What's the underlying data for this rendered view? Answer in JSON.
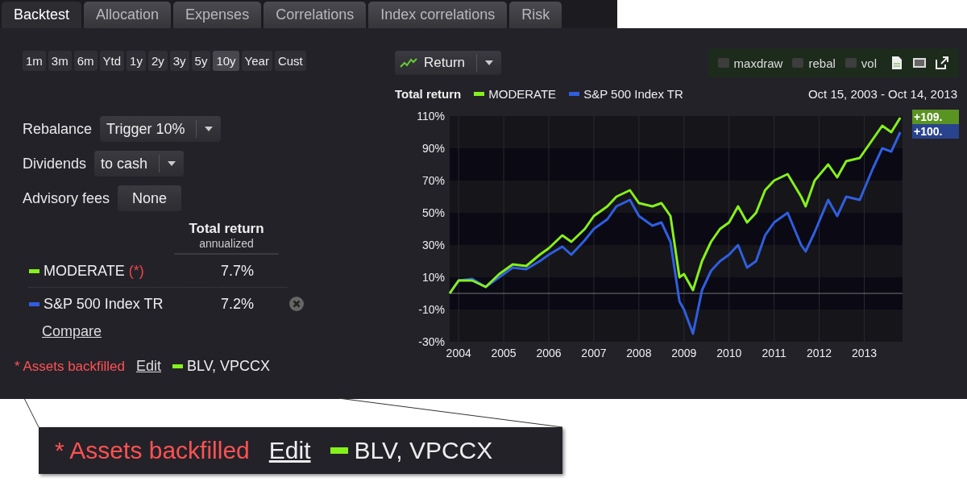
{
  "tabs": [
    {
      "label": "Backtest",
      "selected": true
    },
    {
      "label": "Allocation",
      "selected": false
    },
    {
      "label": "Expenses",
      "selected": false
    },
    {
      "label": "Correlations",
      "selected": false
    },
    {
      "label": "Index correlations",
      "selected": false
    },
    {
      "label": "Risk",
      "selected": false
    }
  ],
  "ranges": [
    {
      "label": "1m",
      "selected": false
    },
    {
      "label": "3m",
      "selected": false
    },
    {
      "label": "6m",
      "selected": false
    },
    {
      "label": "Ytd",
      "selected": false
    },
    {
      "label": "1y",
      "selected": false
    },
    {
      "label": "2y",
      "selected": false
    },
    {
      "label": "3y",
      "selected": false
    },
    {
      "label": "5y",
      "selected": false
    },
    {
      "label": "10y",
      "selected": true
    },
    {
      "label": "Year",
      "selected": false
    },
    {
      "label": "Cust",
      "selected": false
    }
  ],
  "settings": [
    {
      "label": "Rebalance",
      "kind": "dropdown",
      "value": "Trigger 10%"
    },
    {
      "label": "Dividends",
      "kind": "dropdown",
      "value": "to cash"
    },
    {
      "label": "Advisory fees",
      "kind": "button",
      "value": "None"
    }
  ],
  "results": {
    "header": "Total return",
    "subheader": "annualized",
    "rows": [
      {
        "name": "MODERATE",
        "note": "(*)",
        "value": "7.7%",
        "color": "#86f01c",
        "removable": false
      },
      {
        "name": "S&P 500 Index TR",
        "value": "7.2%",
        "color": "#2f5fe0",
        "removable": true
      }
    ],
    "compare": "Compare"
  },
  "footer": {
    "note": "* Assets backfilled",
    "edit": "Edit",
    "color": "#86f01c",
    "assets": "BLV, VPCCX"
  },
  "chart_toolbar": {
    "mode": "Return",
    "options": [
      {
        "label": "maxdraw",
        "checked": false
      },
      {
        "label": "rebal",
        "checked": false
      },
      {
        "label": "vol",
        "checked": false
      }
    ]
  },
  "chart_header": {
    "title": "Total return",
    "date_range": "Oct 15, 2003 - Oct 14, 2013"
  },
  "chart_data": {
    "type": "line",
    "x": [
      2003.8,
      2004.0,
      2004.3,
      2004.6,
      2004.9,
      2005.2,
      2005.5,
      2005.8,
      2006.0,
      2006.3,
      2006.5,
      2006.8,
      2007.0,
      2007.3,
      2007.5,
      2007.8,
      2008.0,
      2008.3,
      2008.5,
      2008.7,
      2008.9,
      2009.0,
      2009.2,
      2009.4,
      2009.6,
      2009.8,
      2010.0,
      2010.2,
      2010.4,
      2010.6,
      2010.8,
      2011.0,
      2011.3,
      2011.6,
      2011.7,
      2011.9,
      2012.2,
      2012.4,
      2012.6,
      2012.9,
      2013.2,
      2013.4,
      2013.6,
      2013.8
    ],
    "series": [
      {
        "name": "MODERATE",
        "color": "#86f01c",
        "values": [
          0,
          8,
          8,
          4,
          12,
          18,
          17,
          24,
          28,
          36,
          32,
          40,
          48,
          54,
          60,
          64,
          56,
          54,
          56,
          48,
          10,
          12,
          2,
          20,
          32,
          40,
          44,
          54,
          44,
          50,
          64,
          70,
          74,
          60,
          54,
          70,
          80,
          72,
          82,
          84,
          96,
          104,
          100,
          109
        ]
      },
      {
        "name": "S&P 500 Index TR",
        "color": "#2f5fe0",
        "values": [
          0,
          8,
          9,
          4,
          10,
          16,
          15,
          20,
          24,
          29,
          24,
          33,
          40,
          46,
          54,
          58,
          48,
          42,
          44,
          32,
          -5,
          -10,
          -25,
          2,
          14,
          20,
          24,
          30,
          16,
          20,
          36,
          44,
          50,
          30,
          26,
          38,
          58,
          48,
          60,
          58,
          78,
          90,
          88,
          100
        ]
      }
    ],
    "xlim": [
      2003.8,
      2013.85
    ],
    "ylim": [
      -30,
      110
    ],
    "grid": true,
    "annotations": [
      {
        "text": "+109."
      },
      {
        "text": "+100."
      }
    ],
    "xticks": [
      {
        "value": 2004,
        "label": "2004"
      },
      {
        "value": 2005,
        "label": "2005"
      },
      {
        "value": 2006,
        "label": "2006"
      },
      {
        "value": 2007,
        "label": "2007"
      },
      {
        "value": 2008,
        "label": "2008"
      },
      {
        "value": 2009,
        "label": "2009"
      },
      {
        "value": 2010,
        "label": "2010"
      },
      {
        "value": 2011,
        "label": "2011"
      },
      {
        "value": 2012,
        "label": "2012"
      },
      {
        "value": 2013,
        "label": "2013"
      }
    ],
    "yticks": [
      {
        "value": 110,
        "label": "110%"
      },
      {
        "value": 90,
        "label": "90%"
      },
      {
        "value": 70,
        "label": "70%"
      },
      {
        "value": 50,
        "label": "50%"
      },
      {
        "value": 30,
        "label": "30%"
      },
      {
        "value": 10,
        "label": "10%"
      },
      {
        "value": -10,
        "label": "-10%"
      },
      {
        "value": -30,
        "label": "-30%"
      }
    ]
  },
  "callout": {
    "note": "* Assets backfilled",
    "edit": "Edit",
    "color": "#86f01c",
    "assets": "BLV, VPCCX"
  }
}
